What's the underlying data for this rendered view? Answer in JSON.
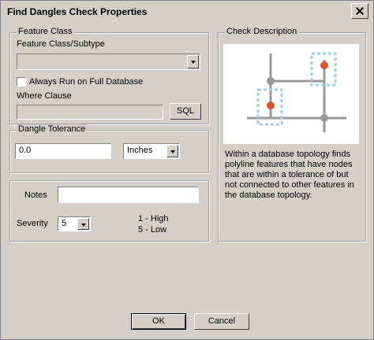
{
  "window": {
    "title": "Find Dangles Check Properties"
  },
  "feature_class": {
    "group_label": "Feature Class",
    "subtype_label": "Feature Class/Subtype",
    "subtype_value": "",
    "always_run_label": "Always Run on Full Database",
    "always_run_checked": false,
    "where_clause_label": "Where Clause",
    "where_clause_value": "",
    "sql_button": "SQL"
  },
  "dangle_tolerance": {
    "group_label": "Dangle Tolerance",
    "value": "0.0",
    "unit": "Inches"
  },
  "notes": {
    "label": "Notes",
    "value": ""
  },
  "severity": {
    "label": "Severity",
    "value": "5",
    "legend_high": "1 - High",
    "legend_low": "5 - Low"
  },
  "check_description": {
    "group_label": "Check Description",
    "text": "Within a database topology finds polyline features that have nodes that are within a tolerance of but not connected to other features in the database topology."
  },
  "buttons": {
    "ok": "OK",
    "cancel": "Cancel"
  },
  "colors": {
    "dialog_bg": "#d4d0c8",
    "node_red": "#e0522c",
    "highlight_blue": "#9ecfee",
    "line_gray": "#999999"
  }
}
